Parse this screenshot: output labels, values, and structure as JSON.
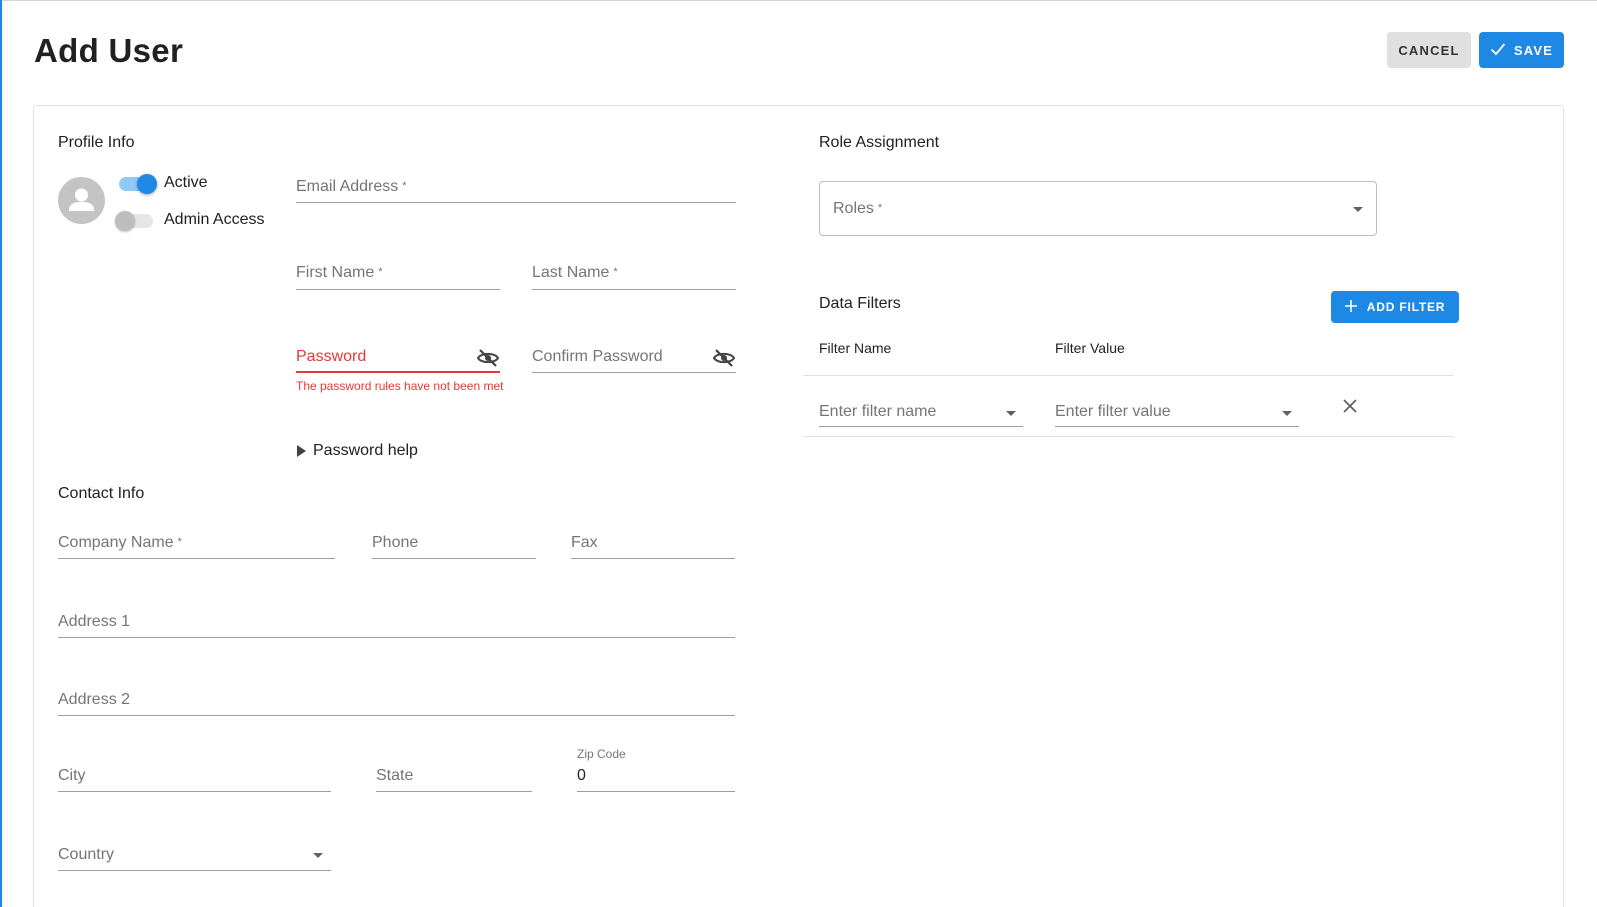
{
  "page": {
    "title": "Add User"
  },
  "toolbar": {
    "cancel_label": "CANCEL",
    "save_label": "SAVE"
  },
  "profile": {
    "section_title": "Profile Info",
    "active_label": "Active",
    "active_on": true,
    "admin_label": "Admin Access",
    "admin_on": false,
    "email_label": "Email Address",
    "first_name_label": "First Name",
    "last_name_label": "Last Name",
    "password_label": "Password",
    "password_error": "The password rules have not been met",
    "confirm_password_label": "Confirm Password",
    "password_help_label": "Password help",
    "required_mark": "*"
  },
  "contact": {
    "section_title": "Contact Info",
    "company_label": "Company Name",
    "phone_label": "Phone",
    "fax_label": "Fax",
    "address1_label": "Address 1",
    "address2_label": "Address 2",
    "city_label": "City",
    "state_label": "State",
    "zip_label": "Zip Code",
    "zip_value": "0",
    "country_label": "Country"
  },
  "roles": {
    "section_title": "Role Assignment",
    "roles_label": "Roles"
  },
  "filters": {
    "section_title": "Data Filters",
    "add_filter_label": "ADD FILTER",
    "col_name": "Filter Name",
    "col_value": "Filter Value",
    "rows": [
      {
        "name_placeholder": "Enter filter name",
        "value_placeholder": "Enter filter value"
      }
    ]
  },
  "colors": {
    "primary": "#1e88e5",
    "error": "#e53935",
    "toggle_track_on": "#90caf9"
  },
  "icons": {
    "save": "check-icon",
    "add_filter": "plus-icon",
    "password_visibility": "eye-off-icon",
    "avatar": "person-icon",
    "dropdown": "caret-down-icon",
    "remove_filter": "close-icon",
    "password_help": "triangle-right-icon"
  }
}
